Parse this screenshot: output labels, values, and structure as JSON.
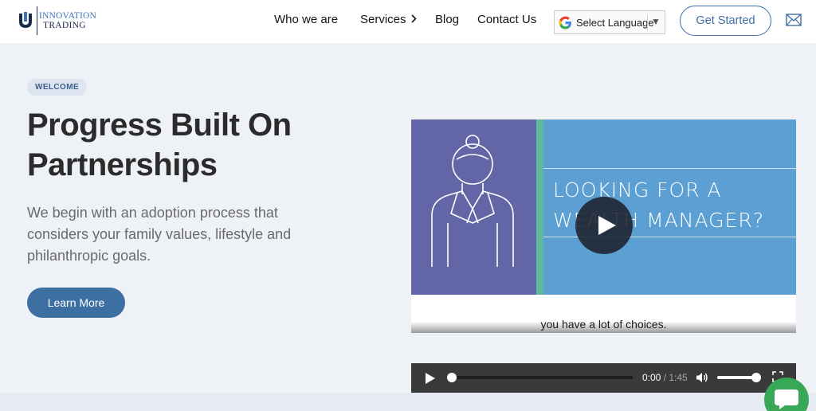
{
  "header": {
    "logo": {
      "line1": "INNOVATION",
      "line2": "TRADING"
    },
    "nav": {
      "who_we_are": "Who we are",
      "services": "Services",
      "blog": "Blog",
      "contact_us": "Contact Us"
    },
    "language_select": {
      "label": "Select Language",
      "icon": "google-g-icon"
    },
    "get_started": "Get Started",
    "mail_icon": "envelope-icon"
  },
  "hero": {
    "badge": "WELCOME",
    "title_line1": "Progress Built On",
    "title_line2": "Partnerships",
    "subtitle": "We begin with an adoption process that considers your family values, lifestyle and philanthropic goals.",
    "cta": "Learn More"
  },
  "video": {
    "heading_line1": "LOOKING FOR A",
    "heading_line2": "WEALTH MANAGER?",
    "caption": "you have a lot of choices.",
    "current_time": "0:00",
    "separator": " / ",
    "duration": "1:45",
    "progress_fraction": 0.0,
    "volume_fraction": 1.0
  },
  "colors": {
    "accent": "#3e6fa3",
    "video_purple": "#6366a6",
    "video_green": "#5fb89c",
    "video_blue": "#5c9fd2",
    "chat_green": "#38a856"
  }
}
